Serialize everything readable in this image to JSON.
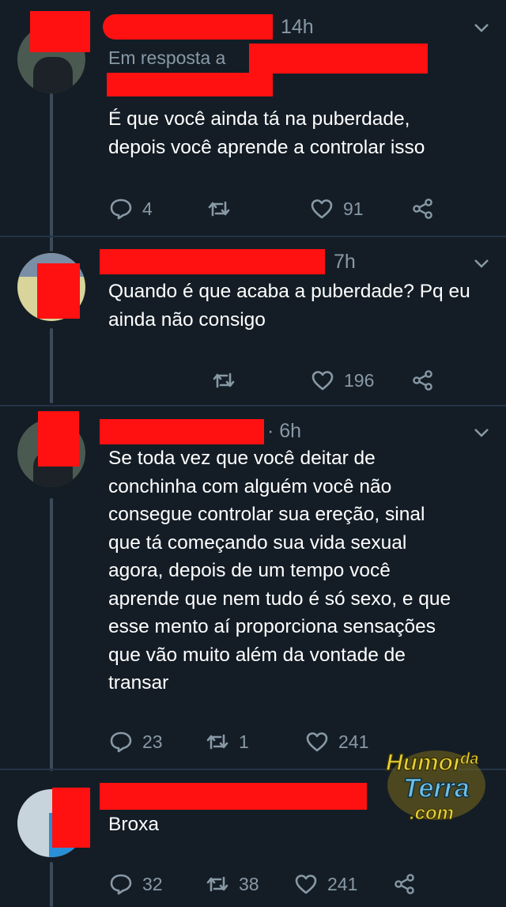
{
  "tweets": [
    {
      "time": "14h",
      "reply_prefix": "Em resposta a",
      "text": "É que você ainda tá na puberdade,\ndepois você aprende a controlar isso",
      "replies": "4",
      "retweets": "",
      "likes": "91"
    },
    {
      "time": "7h",
      "text": "Quando é que acaba a puberdade? Pq eu\nainda não consigo",
      "retweets": "",
      "likes": "196"
    },
    {
      "time": "· 6h",
      "text": "Se toda vez que você deitar de\nconchinha com alguém você não\nconsegue controlar sua ereção, sinal\nque tá começando sua vida sexual\nagora, depois de um tempo você\naprende que nem tudo é só sexo, e que\nesse mento aí proporciona sensações\nque vão muito além da vontade de\ntransar",
      "replies": "23",
      "retweets": "1",
      "likes": "241"
    },
    {
      "text": "Broxa",
      "replies": "32",
      "retweets": "38",
      "likes": "241"
    }
  ],
  "watermark": {
    "line1": "Humor",
    "da": "da",
    "line2": "Terra",
    "line3": ".com"
  },
  "colors": {
    "background": "#141d26",
    "muted": "#8899a6",
    "redaction": "#ff1111",
    "divider": "#243447"
  }
}
